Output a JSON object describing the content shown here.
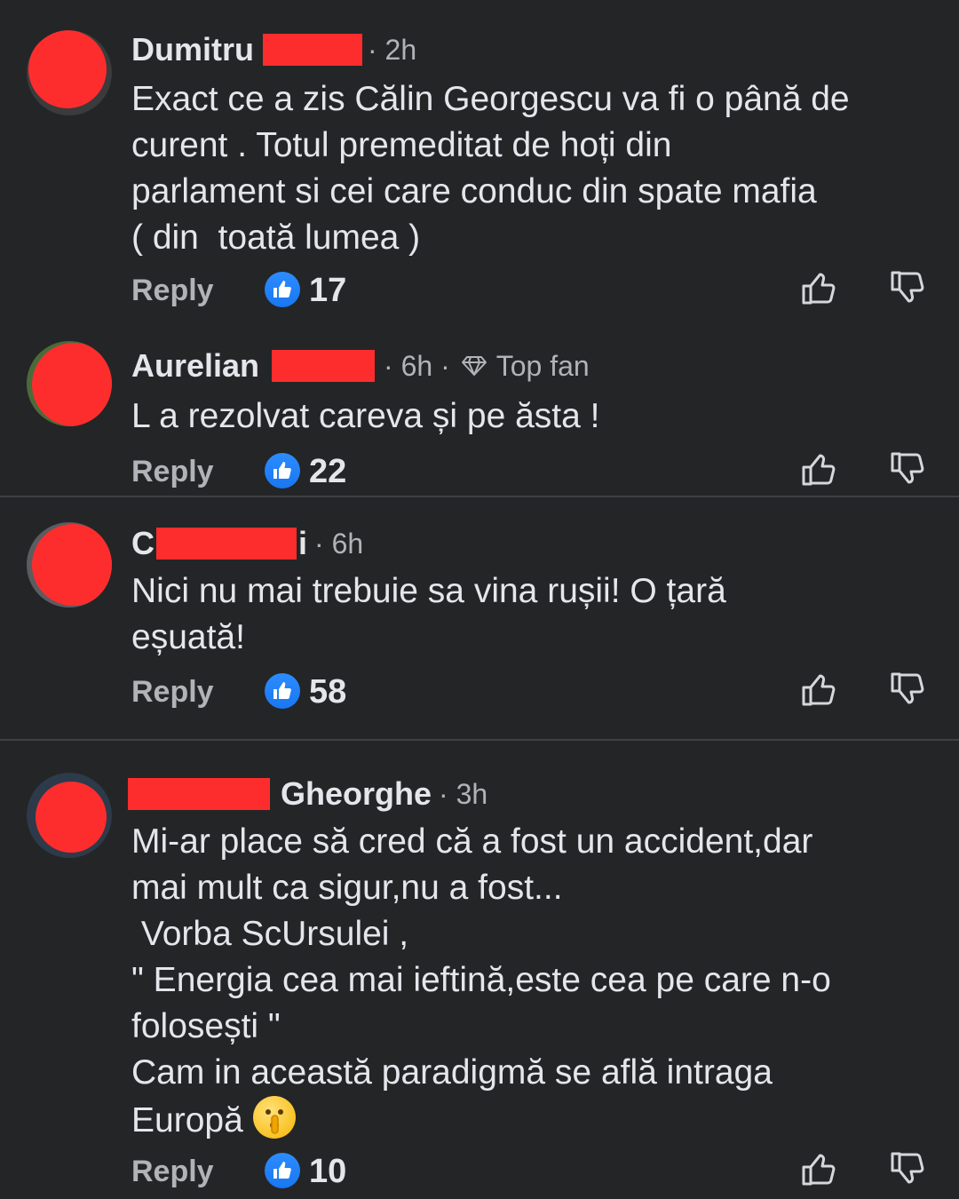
{
  "comments": [
    {
      "name": "Dumitru",
      "time": "· 2h",
      "text": "Exact ce a zis Călin Georgescu va fi o până de\ncurent . Totul premeditat de hoți din\nparlament si cei care conduc din spate mafia\n( din  toată lumea )",
      "reply": "Reply",
      "likes": "17"
    },
    {
      "name": "Aurelian",
      "time": "· 6h ·",
      "badge": "Top fan",
      "text": "L a rezolvat careva și pe ăsta !",
      "reply": "Reply",
      "likes": "22"
    },
    {
      "name_start": "C",
      "name_end": "i",
      "time": "· 6h",
      "text": "Nici nu mai trebuie sa vina rușii! O țară\neșuată!",
      "reply": "Reply",
      "likes": "58"
    },
    {
      "name": "Gheorghe",
      "time": "· 3h",
      "text": "Mi-ar place să cred că a fost un accident,dar\nmai mult ca sigur,nu a fost...\n Vorba ScUrsulei ,\n\" Energia cea mai ieftină,este cea pe care n-o\nfolosești \"\nCam in această paradigmă se află intraga\nEuropă",
      "reply": "Reply",
      "likes": "10"
    }
  ],
  "icons": {
    "like_badge": "thumbs-up-icon",
    "like": "thumbs-up-outline-icon",
    "dislike": "thumbs-down-outline-icon",
    "top_fan": "diamond-icon",
    "emoji": "shushing-face-emoji"
  },
  "colors": {
    "background": "#242526",
    "text": "#e4e6eb",
    "muted": "#b0b3b8",
    "redaction": "#fe2d2d",
    "like_blue": "#1877f2"
  }
}
